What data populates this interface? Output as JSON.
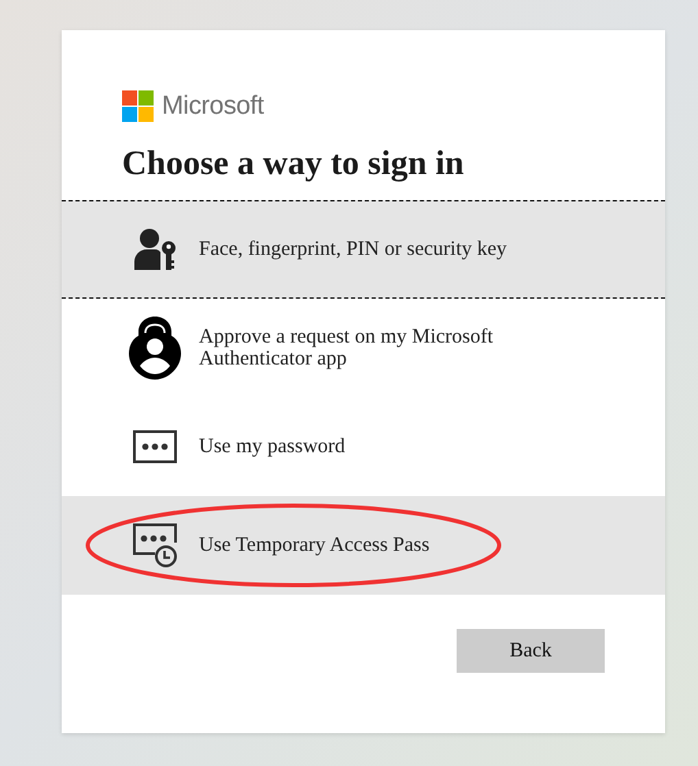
{
  "logo": {
    "text": "Microsoft"
  },
  "title": "Choose a way to sign in",
  "options": [
    {
      "kind": "person-key",
      "label": "Face, fingerprint, PIN or security key",
      "focused": true,
      "highlighted": true,
      "circled": false
    },
    {
      "kind": "authenticator",
      "label": "Approve a request on my Microsoft Authenticator app",
      "focused": false,
      "highlighted": false,
      "circled": false
    },
    {
      "kind": "password",
      "label": "Use my password",
      "focused": false,
      "highlighted": false,
      "circled": false
    },
    {
      "kind": "temporary-pass",
      "label": "Use Temporary Access Pass",
      "focused": false,
      "highlighted": true,
      "circled": true
    }
  ],
  "buttons": [
    {
      "label": "Back"
    }
  ]
}
